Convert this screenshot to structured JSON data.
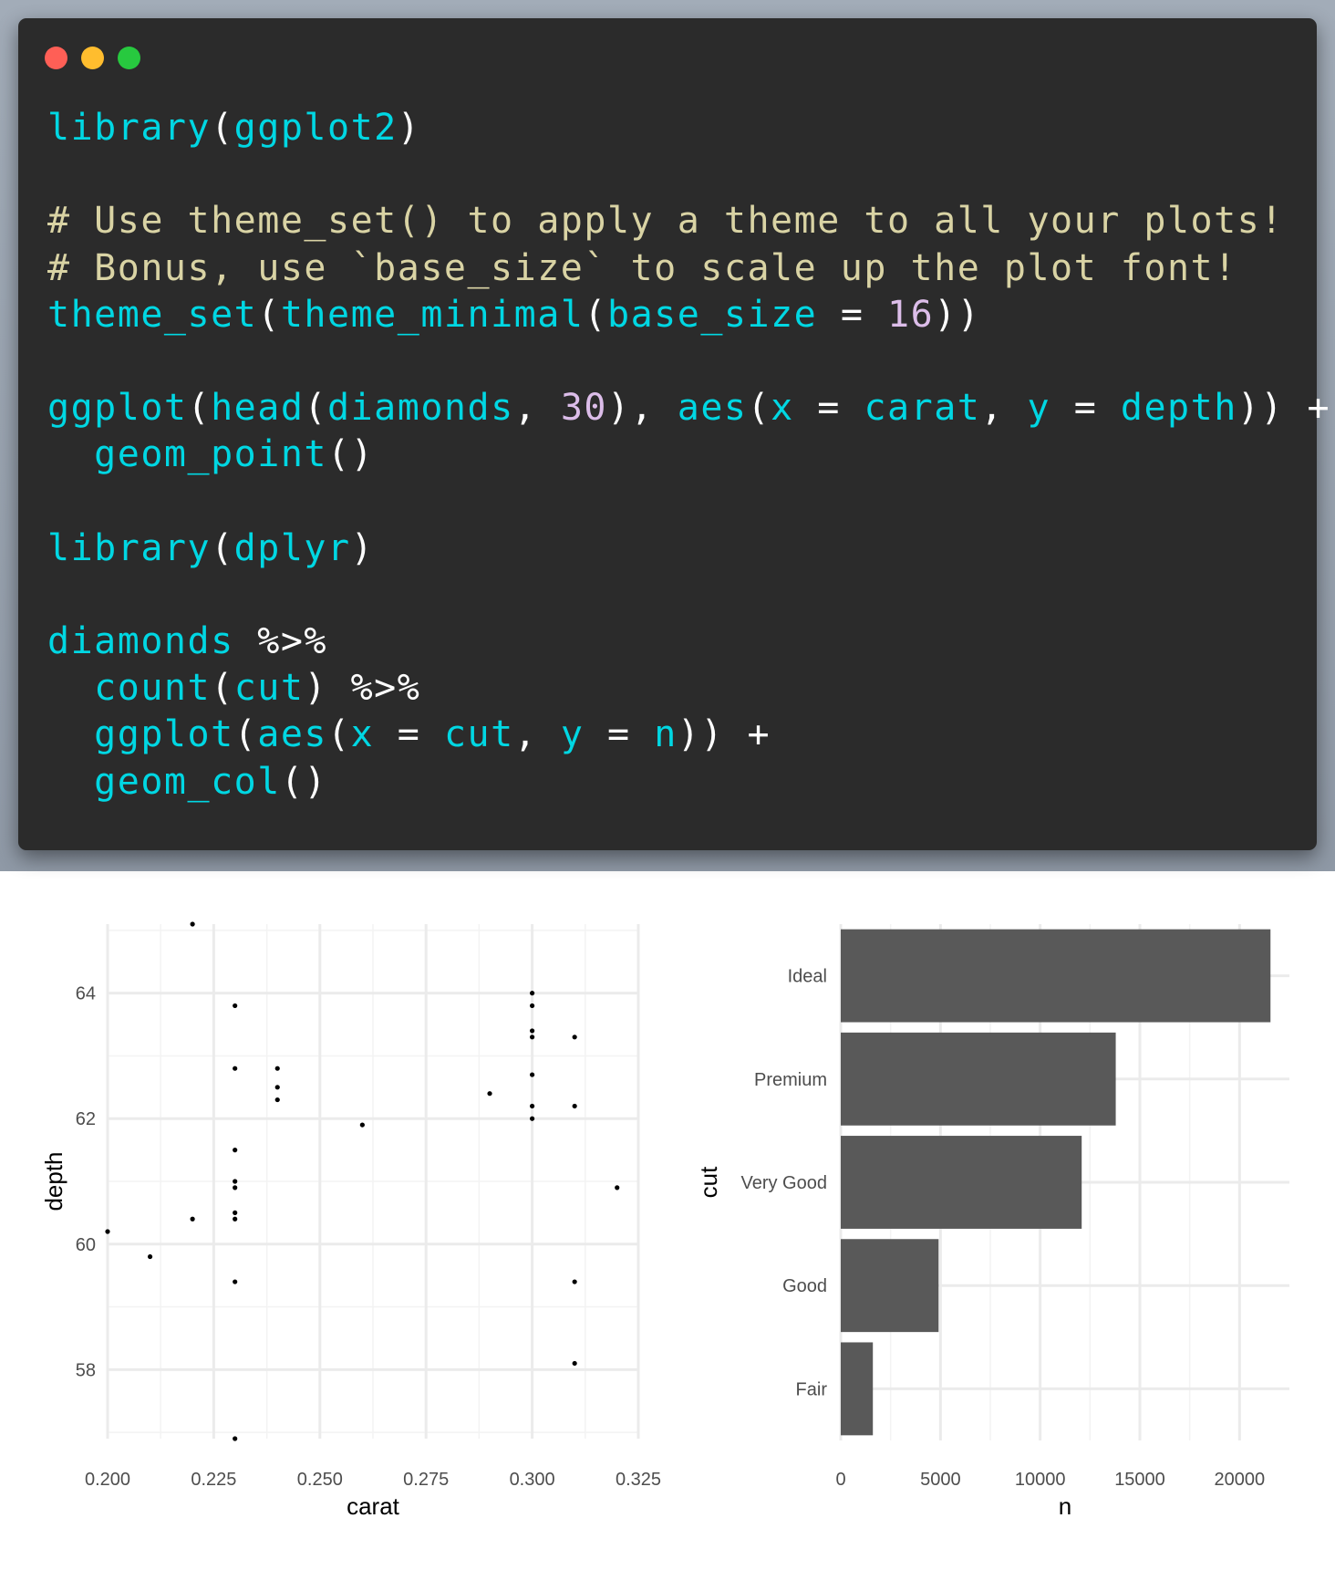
{
  "window": {
    "controls": [
      "close-dot",
      "minimize-dot",
      "zoom-dot"
    ],
    "colors": {
      "close": "#ff5f56",
      "minimize": "#ffbd2e",
      "zoom": "#27c93f",
      "background": "#2b2b2b"
    }
  },
  "code": {
    "l1_a": "library",
    "l1_b": "(",
    "l1_c": "ggplot2",
    "l1_d": ")",
    "l3": "# Use theme_set() to apply a theme to all your plots!",
    "l4": "# Bonus, use `base_size` to scale up the plot font!",
    "l5_a": "theme_set",
    "l5_b": "(",
    "l5_c": "theme_minimal",
    "l5_d": "(",
    "l5_e": "base_size",
    "l5_f": " = ",
    "l5_g": "16",
    "l5_h": "))",
    "l7_a": "ggplot",
    "l7_b": "(",
    "l7_c": "head",
    "l7_d": "(",
    "l7_e": "diamonds",
    "l7_f": ", ",
    "l7_g": "30",
    "l7_h": "), ",
    "l7_i": "aes",
    "l7_j": "(",
    "l7_k": "x",
    "l7_l": " = ",
    "l7_m": "carat",
    "l7_n": ", ",
    "l7_o": "y",
    "l7_p": " = ",
    "l7_q": "depth",
    "l7_r": ")) +",
    "l8_a": "  ",
    "l8_b": "geom_point",
    "l8_c": "()",
    "l10_a": "library",
    "l10_b": "(",
    "l10_c": "dplyr",
    "l10_d": ")",
    "l12_a": "diamonds",
    "l12_b": " %>%",
    "l13_a": "  ",
    "l13_b": "count",
    "l13_c": "(",
    "l13_d": "cut",
    "l13_e": ") %>%",
    "l14_a": "  ",
    "l14_b": "ggplot",
    "l14_c": "(",
    "l14_d": "aes",
    "l14_e": "(",
    "l14_f": "x",
    "l14_g": " = ",
    "l14_h": "cut",
    "l14_i": ", ",
    "l14_j": "y",
    "l14_k": " = ",
    "l14_l": "n",
    "l14_m": ")) +",
    "l15_a": "  ",
    "l15_b": "geom_col",
    "l15_c": "()",
    "colors": {
      "function": "#00d7e3",
      "comment": "#d9d3a4",
      "number": "#dcbde9",
      "operator": "#ffffff"
    }
  },
  "chart_data": [
    {
      "type": "scatter",
      "title": "",
      "xlabel": "carat",
      "ylabel": "depth",
      "xlim": [
        0.2,
        0.325
      ],
      "ylim": [
        56.9,
        65.1
      ],
      "xticks": [
        0.2,
        0.225,
        0.25,
        0.275,
        0.3,
        0.325
      ],
      "xtick_labels": [
        "0.200",
        "0.225",
        "0.250",
        "0.275",
        "0.300",
        "0.325"
      ],
      "yticks": [
        58,
        60,
        62,
        64
      ],
      "ytick_labels": [
        "58",
        "60",
        "62",
        "64"
      ],
      "grid": true,
      "point_color": "#000000",
      "points": [
        [
          0.23,
          61.5
        ],
        [
          0.21,
          59.8
        ],
        [
          0.23,
          56.9
        ],
        [
          0.29,
          62.4
        ],
        [
          0.31,
          63.3
        ],
        [
          0.24,
          62.8
        ],
        [
          0.24,
          62.3
        ],
        [
          0.26,
          61.9
        ],
        [
          0.22,
          65.1
        ],
        [
          0.23,
          59.4
        ],
        [
          0.3,
          64.0
        ],
        [
          0.23,
          62.8
        ],
        [
          0.22,
          60.4
        ],
        [
          0.31,
          62.2
        ],
        [
          0.2,
          60.2
        ],
        [
          0.32,
          60.9
        ],
        [
          0.3,
          62.0
        ],
        [
          0.3,
          63.4
        ],
        [
          0.3,
          63.8
        ],
        [
          0.3,
          62.7
        ],
        [
          0.3,
          63.3
        ],
        [
          0.23,
          63.8
        ],
        [
          0.23,
          61.0
        ],
        [
          0.31,
          59.4
        ],
        [
          0.31,
          58.1
        ],
        [
          0.24,
          62.5
        ],
        [
          0.23,
          60.5
        ],
        [
          0.23,
          60.9
        ],
        [
          0.3,
          62.2
        ],
        [
          0.23,
          60.4
        ]
      ]
    },
    {
      "type": "bar",
      "orientation": "horizontal",
      "title": "",
      "xlabel": "n",
      "ylabel": "cut",
      "categories": [
        "Fair",
        "Good",
        "Very Good",
        "Premium",
        "Ideal"
      ],
      "values": [
        1610,
        4906,
        12082,
        13791,
        21551
      ],
      "xlim": [
        0,
        22500
      ],
      "xticks": [
        0,
        5000,
        10000,
        15000,
        20000
      ],
      "xtick_labels": [
        "0",
        "5000",
        "10000",
        "15000",
        "20000"
      ],
      "grid": true,
      "bar_color": "#595959"
    }
  ]
}
